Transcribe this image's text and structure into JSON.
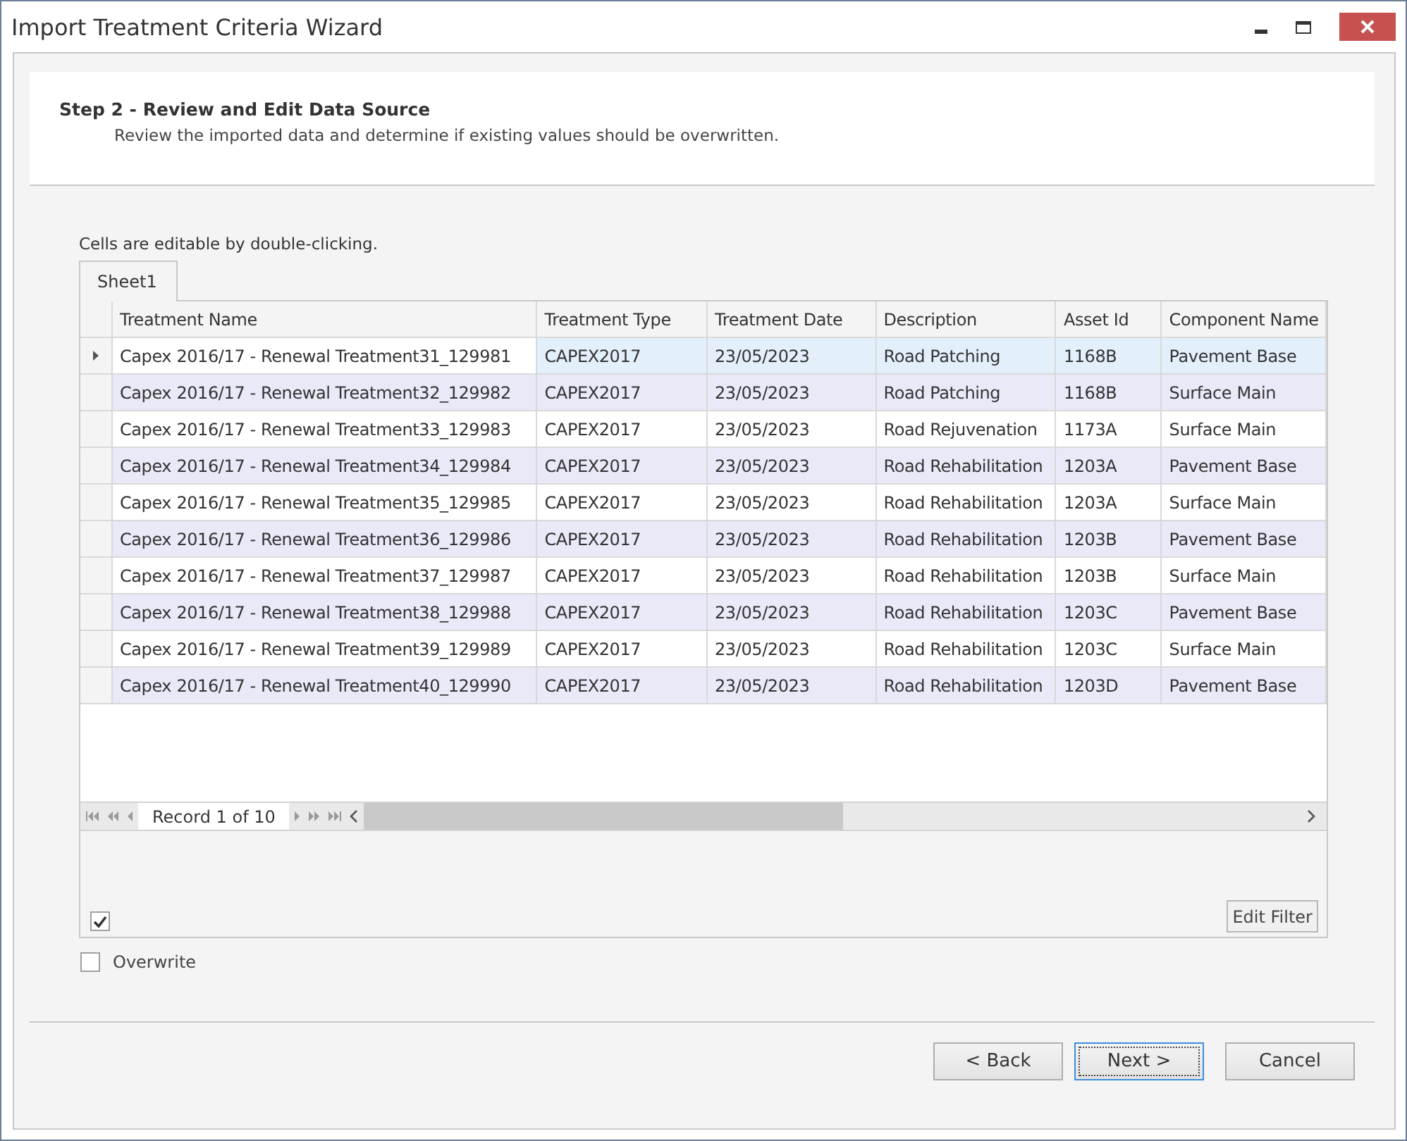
{
  "window": {
    "title": "Import Treatment Criteria Wizard"
  },
  "header": {
    "title": "Step 2 - Review and Edit Data Source",
    "subtitle": "Review the imported data and determine if existing values should be overwritten."
  },
  "hint": "Cells are editable by double-clicking.",
  "sheet_tabs": [
    {
      "label": "Sheet1",
      "selected": true
    }
  ],
  "table": {
    "columns": [
      "Treatment Name",
      "Treatment Type",
      "Treatment Date",
      "Description",
      "Asset Id",
      "Component Name"
    ],
    "rows": [
      {
        "selected": true,
        "cells": [
          "Capex 2016/17 - Renewal Treatment31_129981",
          "CAPEX2017",
          "23/05/2023",
          "Road Patching",
          "1168B",
          "Pavement Base"
        ]
      },
      {
        "selected": false,
        "cells": [
          "Capex 2016/17 - Renewal Treatment32_129982",
          "CAPEX2017",
          "23/05/2023",
          "Road Patching",
          "1168B",
          "Surface Main"
        ]
      },
      {
        "selected": false,
        "cells": [
          "Capex 2016/17 - Renewal Treatment33_129983",
          "CAPEX2017",
          "23/05/2023",
          "Road Rejuvenation",
          "1173A",
          "Surface Main"
        ]
      },
      {
        "selected": false,
        "cells": [
          "Capex 2016/17 - Renewal Treatment34_129984",
          "CAPEX2017",
          "23/05/2023",
          "Road Rehabilitation",
          "1203A",
          "Pavement Base"
        ]
      },
      {
        "selected": false,
        "cells": [
          "Capex 2016/17 - Renewal Treatment35_129985",
          "CAPEX2017",
          "23/05/2023",
          "Road Rehabilitation",
          "1203A",
          "Surface Main"
        ]
      },
      {
        "selected": false,
        "cells": [
          "Capex 2016/17 - Renewal Treatment36_129986",
          "CAPEX2017",
          "23/05/2023",
          "Road Rehabilitation",
          "1203B",
          "Pavement Base"
        ]
      },
      {
        "selected": false,
        "cells": [
          "Capex 2016/17 - Renewal Treatment37_129987",
          "CAPEX2017",
          "23/05/2023",
          "Road Rehabilitation",
          "1203B",
          "Surface Main"
        ]
      },
      {
        "selected": false,
        "cells": [
          "Capex 2016/17 - Renewal Treatment38_129988",
          "CAPEX2017",
          "23/05/2023",
          "Road Rehabilitation",
          "1203C",
          "Pavement Base"
        ]
      },
      {
        "selected": false,
        "cells": [
          "Capex 2016/17 - Renewal Treatment39_129989",
          "CAPEX2017",
          "23/05/2023",
          "Road Rehabilitation",
          "1203C",
          "Surface Main"
        ]
      },
      {
        "selected": false,
        "cells": [
          "Capex 2016/17 - Renewal Treatment40_129990",
          "CAPEX2017",
          "23/05/2023",
          "Road Rehabilitation",
          "1203D",
          "Pavement Base"
        ]
      }
    ]
  },
  "navigator": {
    "record": "Record 1 of 10"
  },
  "filter": {
    "checked": true,
    "button": "Edit Filter"
  },
  "overwrite": {
    "label": "Overwrite",
    "checked": false
  },
  "buttons": [
    {
      "label": "< Back",
      "focused": false
    },
    {
      "label": "Next >",
      "focused": true
    },
    {
      "label": "Cancel",
      "focused": false
    }
  ]
}
